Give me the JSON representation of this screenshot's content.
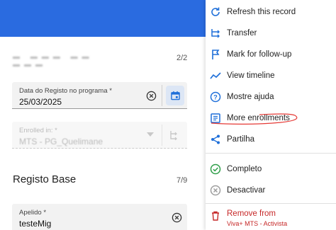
{
  "form": {
    "counter_top": "2/2",
    "enrollment_date": {
      "label": "Data do Registo no programa *",
      "value": "25/03/2025"
    },
    "enrolled_in": {
      "label": "Enrolled in: *",
      "value": "MTS - PG_Quelimane"
    },
    "section_title": "Registo Base",
    "section_counter": "7/9",
    "apelido": {
      "label": "Apelido *",
      "value": "testeMig"
    }
  },
  "menu": {
    "items": [
      {
        "label": "Refresh this record",
        "icon": "refresh-icon"
      },
      {
        "label": "Transfer",
        "icon": "transfer-icon"
      },
      {
        "label": "Mark for follow-up",
        "icon": "flag-icon"
      },
      {
        "label": "View timeline",
        "icon": "timeline-icon"
      },
      {
        "label": "Mostre ajuda",
        "icon": "help-icon"
      },
      {
        "label": "More enrollments",
        "icon": "list-icon"
      },
      {
        "label": "Partilha",
        "icon": "share-icon"
      },
      {
        "label": "Completo",
        "icon": "check-circle-icon"
      },
      {
        "label": "Desactivar",
        "icon": "cancel-circle-icon"
      },
      {
        "label": "Remove from",
        "icon": "trash-icon"
      }
    ],
    "remove_sub": "Viva+ MTS - Activista"
  },
  "colors": {
    "primary": "#2a6be0",
    "danger": "#c62828",
    "icon": "#1e6fd9",
    "annotation": "#e53935"
  }
}
